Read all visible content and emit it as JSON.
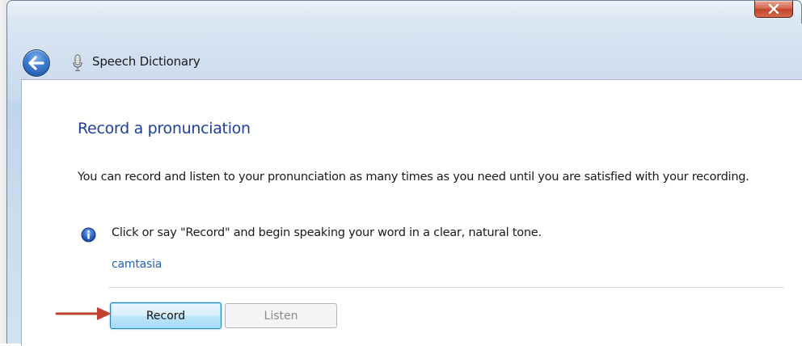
{
  "window": {
    "title": "Speech Dictionary",
    "close_label": "x"
  },
  "content": {
    "heading": "Record a pronunciation",
    "description": "You can record and listen to your pronunciation as many times as you need until you are satisfied with your recording.",
    "instruction": "Click or say \"Record\" and begin speaking your word in a clear, natural tone.",
    "word": "camtasia"
  },
  "buttons": {
    "record_label": "Record",
    "listen_label": "Listen",
    "listen_enabled": false
  },
  "icons": {
    "back": "back-arrow-icon",
    "microphone": "microphone-icon",
    "info": "info-icon",
    "annotation": "red-arrow-icon"
  },
  "colors": {
    "heading": "#1e3e9a",
    "word_link": "#1e62b5",
    "annotation_arrow": "#c0422c"
  }
}
